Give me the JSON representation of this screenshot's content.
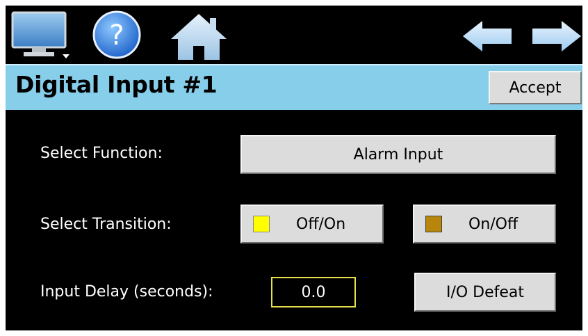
{
  "toolbar": {
    "icons": [
      "monitor-icon",
      "help-icon",
      "home-icon",
      "back-arrow-icon",
      "forward-arrow-icon"
    ],
    "help_glyph": "?"
  },
  "header": {
    "title": "Digital Input #1",
    "accept_label": "Accept",
    "bar_color": "#87ceeb"
  },
  "form": {
    "function_label": "Select Function:",
    "function_value": "Alarm Input",
    "transition_label": "Select Transition:",
    "transition_options": [
      {
        "label": "Off/On",
        "color": "#ffff00",
        "selected": true
      },
      {
        "label": "On/Off",
        "color": "#b8860b",
        "selected": false
      }
    ],
    "delay_label": "Input Delay (seconds):",
    "delay_value": "0.0",
    "defeat_label": "I/O Defeat"
  }
}
